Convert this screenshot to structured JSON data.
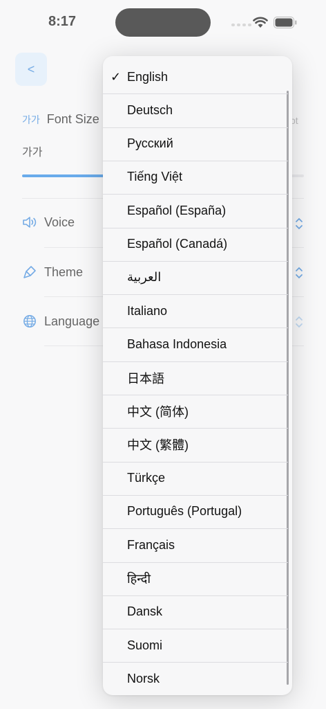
{
  "status_bar": {
    "time": "8:17"
  },
  "page": {
    "back_label": "<",
    "font_size": {
      "glyph": "가가",
      "label": "Font Size",
      "value_partial": "pt",
      "preview": "가가",
      "slider_fraction": 0.3
    },
    "settings": [
      {
        "label": "Voice",
        "icon": "speaker-icon"
      },
      {
        "label": "Theme",
        "icon": "paintbrush-icon"
      },
      {
        "label": "Language",
        "icon": "globe-icon"
      }
    ]
  },
  "language_menu": {
    "selected": "English",
    "check_mark": "✓",
    "items": [
      "English",
      "Deutsch",
      "Русский",
      "Tiếng Việt",
      "Español (España)",
      "Español (Canadá)",
      "العربية",
      "Italiano",
      "Bahasa Indonesia",
      "日本語",
      "中文 (简体)",
      "中文 (繁體)",
      "Türkçe",
      "Português (Portugal)",
      "Français",
      "हिन्दी",
      "Dansk",
      "Suomi",
      "Norsk"
    ]
  },
  "colors": {
    "accent": "#1a7fe0",
    "menu_bg": "#f7f7f8",
    "back_bg": "#dbeaf9"
  }
}
